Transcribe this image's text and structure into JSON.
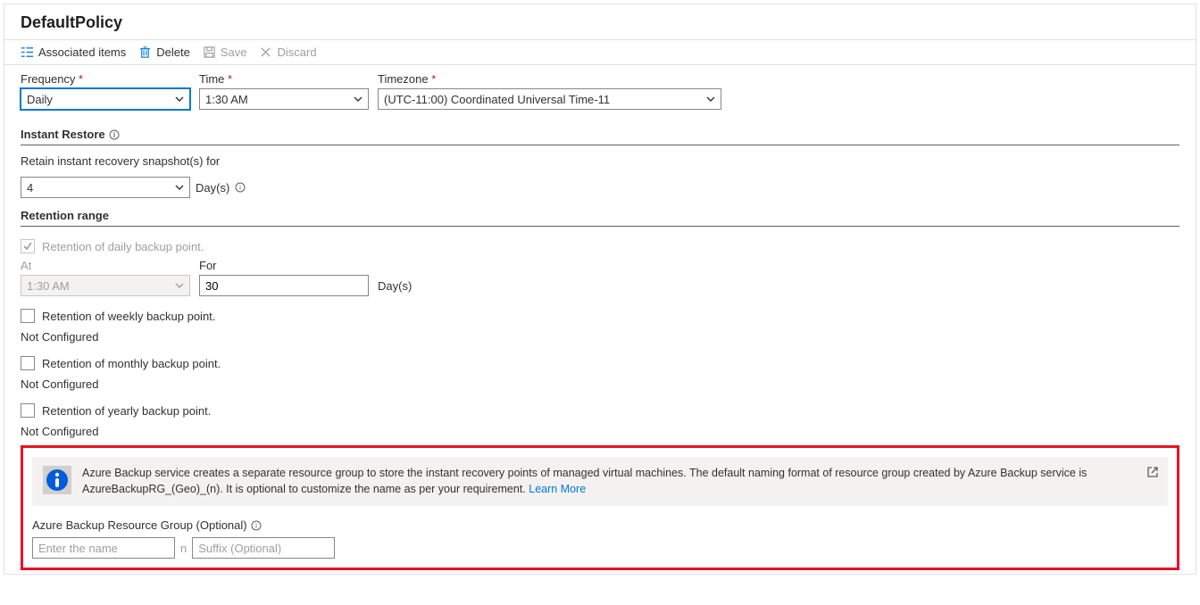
{
  "header": {
    "title": "DefaultPolicy"
  },
  "toolbar": {
    "associated": "Associated items",
    "delete": "Delete",
    "save": "Save",
    "discard": "Discard"
  },
  "schedule": {
    "freq_label": "Frequency",
    "freq_value": "Daily",
    "time_label": "Time",
    "time_value": "1:30 AM",
    "tz_label": "Timezone",
    "tz_value": "(UTC-11:00) Coordinated Universal Time-11"
  },
  "instant": {
    "title": "Instant Restore",
    "retain_label": "Retain instant recovery snapshot(s) for",
    "retain_value": "4",
    "days_unit": "Day(s)"
  },
  "retention": {
    "title": "Retention range",
    "daily_label": "Retention of daily backup point.",
    "at_label": "At",
    "at_value": "1:30 AM",
    "for_label": "For",
    "for_value": "30",
    "days_unit": "Day(s)",
    "weekly_label": "Retention of weekly backup point.",
    "monthly_label": "Retention of monthly backup point.",
    "yearly_label": "Retention of yearly backup point.",
    "not_conf": "Not Configured"
  },
  "rg": {
    "info_text": "Azure Backup service creates a separate resource group to store the instant recovery points of managed virtual machines. The default naming format of resource group created by Azure Backup service is AzureBackupRG_(Geo)_(n). It is optional to customize the name as per your requirement.",
    "learn_more": "Learn More",
    "label": "Azure Backup Resource Group (Optional)",
    "name_ph": "Enter the name",
    "sep": "n",
    "suffix_ph": "Suffix (Optional)"
  }
}
